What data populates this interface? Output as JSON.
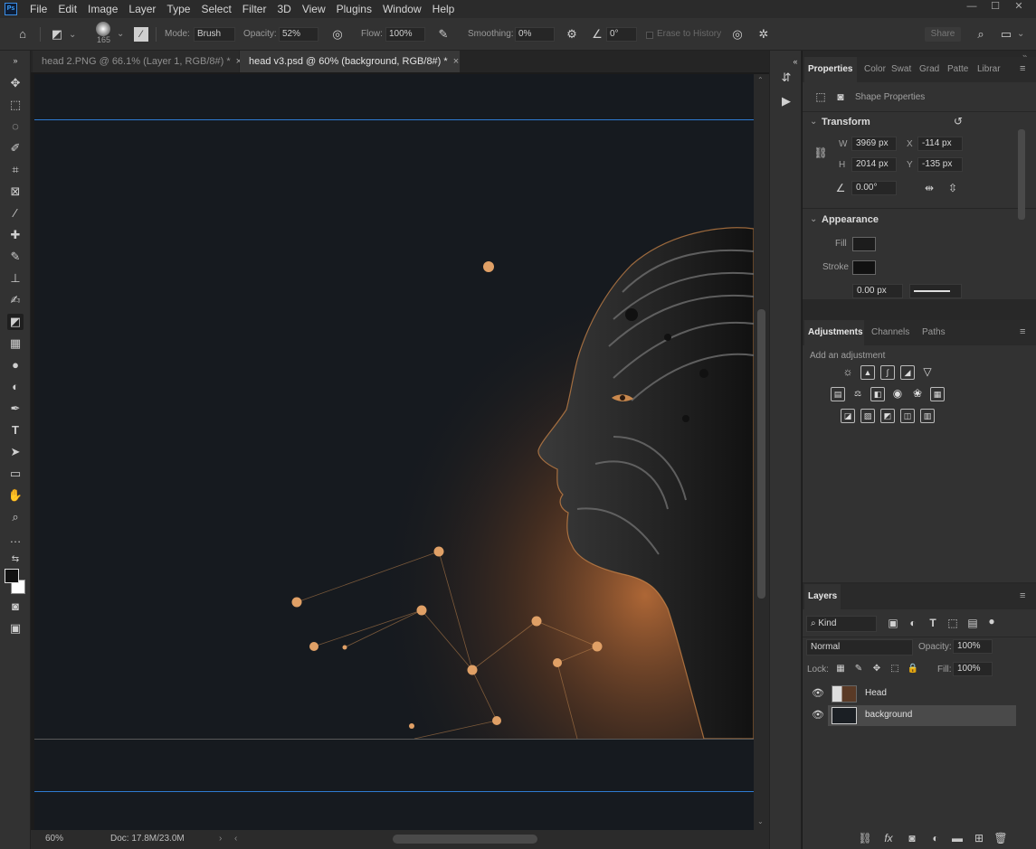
{
  "menubar": {
    "app_icon": "Ps",
    "items": [
      "File",
      "Edit",
      "Image",
      "Layer",
      "Type",
      "Select",
      "Filter",
      "3D",
      "View",
      "Plugins",
      "Window",
      "Help"
    ],
    "window_controls": [
      "—",
      "☐",
      "✕"
    ]
  },
  "options": {
    "brush_size": "165",
    "mode_label": "Mode:",
    "mode_value": "Brush",
    "opacity_label": "Opacity:",
    "opacity_value": "52%",
    "flow_label": "Flow:",
    "flow_value": "100%",
    "smoothing_label": "Smoothing:",
    "smoothing_value": "0%",
    "angle_value": "0°",
    "erase_history": "Erase to History",
    "share_label": "Share"
  },
  "tabs": [
    {
      "label": "head 2.PNG @ 66.1% (Layer 1, RGB/8#) *",
      "active": false
    },
    {
      "label": "head v3.psd @ 60% (background, RGB/8#) *",
      "active": true
    }
  ],
  "status": {
    "zoom": "60%",
    "doc": "Doc: 17.8M/23.0M"
  },
  "properties": {
    "tabs": [
      "Properties",
      "Color",
      "Swat",
      "Grad",
      "Patte",
      "Librar"
    ],
    "subtitle": "Shape Properties",
    "transform_title": "Transform",
    "w_label": "W",
    "w_value": "3969 px",
    "h_label": "H",
    "h_value": "2014 px",
    "x_label": "X",
    "x_value": "-114 px",
    "y_label": "Y",
    "y_value": "-135 px",
    "angle_value": "0.00°",
    "appearance_title": "Appearance",
    "fill_label": "Fill",
    "stroke_label": "Stroke",
    "stroke_width": "0.00 px"
  },
  "adjustments": {
    "tabs": [
      "Adjustments",
      "Channels",
      "Paths"
    ],
    "hint": "Add an adjustment"
  },
  "layers": {
    "tab": "Layers",
    "kind_label": "Kind",
    "blend_mode": "Normal",
    "opacity_label": "Opacity:",
    "opacity_value": "100%",
    "lock_label": "Lock:",
    "fill_label": "Fill:",
    "fill_value": "100%",
    "items": [
      {
        "name": "Head",
        "selected": false
      },
      {
        "name": "background",
        "selected": true
      }
    ],
    "bottom_icons": [
      "link-icon",
      "fx-icon",
      "mask-icon",
      "adjustment-icon",
      "group-icon",
      "new-layer-icon",
      "trash-icon"
    ],
    "fx_text": "fx"
  },
  "colors": {
    "accent_guide": "#2e7ad1",
    "glow": "#c8743a",
    "canvas_bg": "#161a1f"
  }
}
